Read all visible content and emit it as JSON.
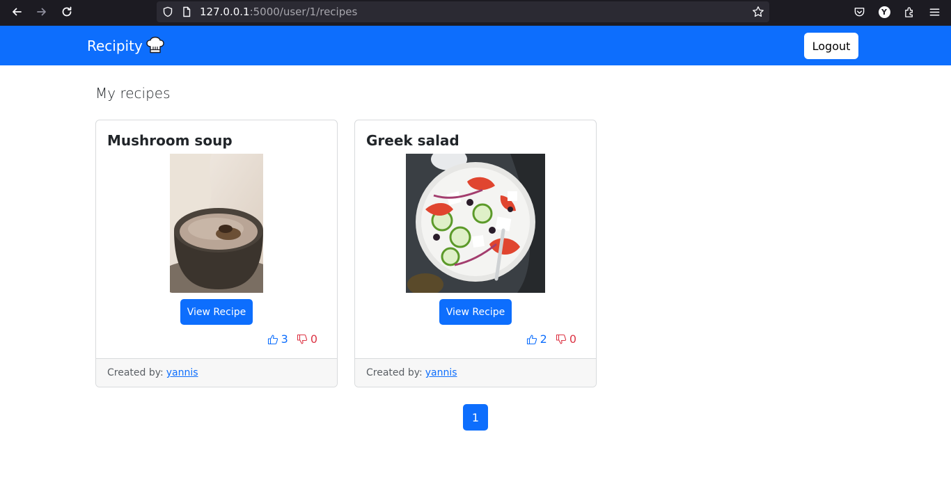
{
  "browser": {
    "url_host": "127.0.0.1",
    "url_path": ":5000/user/1/recipes",
    "icons": [
      "back-icon",
      "forward-icon",
      "reload-icon",
      "shield-icon",
      "page-icon",
      "star-icon",
      "pocket-icon",
      "account-icon",
      "extensions-icon",
      "menu-icon"
    ],
    "account_letter": "Y"
  },
  "navbar": {
    "brand": "Recipity",
    "brand_icon": "chef-hat-icon",
    "logout_label": "Logout",
    "color": "#0d6efd"
  },
  "main": {
    "title": "My recipes",
    "recipes": [
      {
        "title": "Mushroom soup",
        "view_label": "View Recipe",
        "likes": "3",
        "dislikes": "0",
        "created_by_label": "Created by:",
        "author": "yannis"
      },
      {
        "title": "Greek salad",
        "view_label": "View Recipe",
        "likes": "2",
        "dislikes": "0",
        "created_by_label": "Created by:",
        "author": "yannis"
      }
    ],
    "pagination": {
      "current_page": "1"
    }
  },
  "colors": {
    "primary": "#0d6efd",
    "danger": "#dc3545"
  }
}
